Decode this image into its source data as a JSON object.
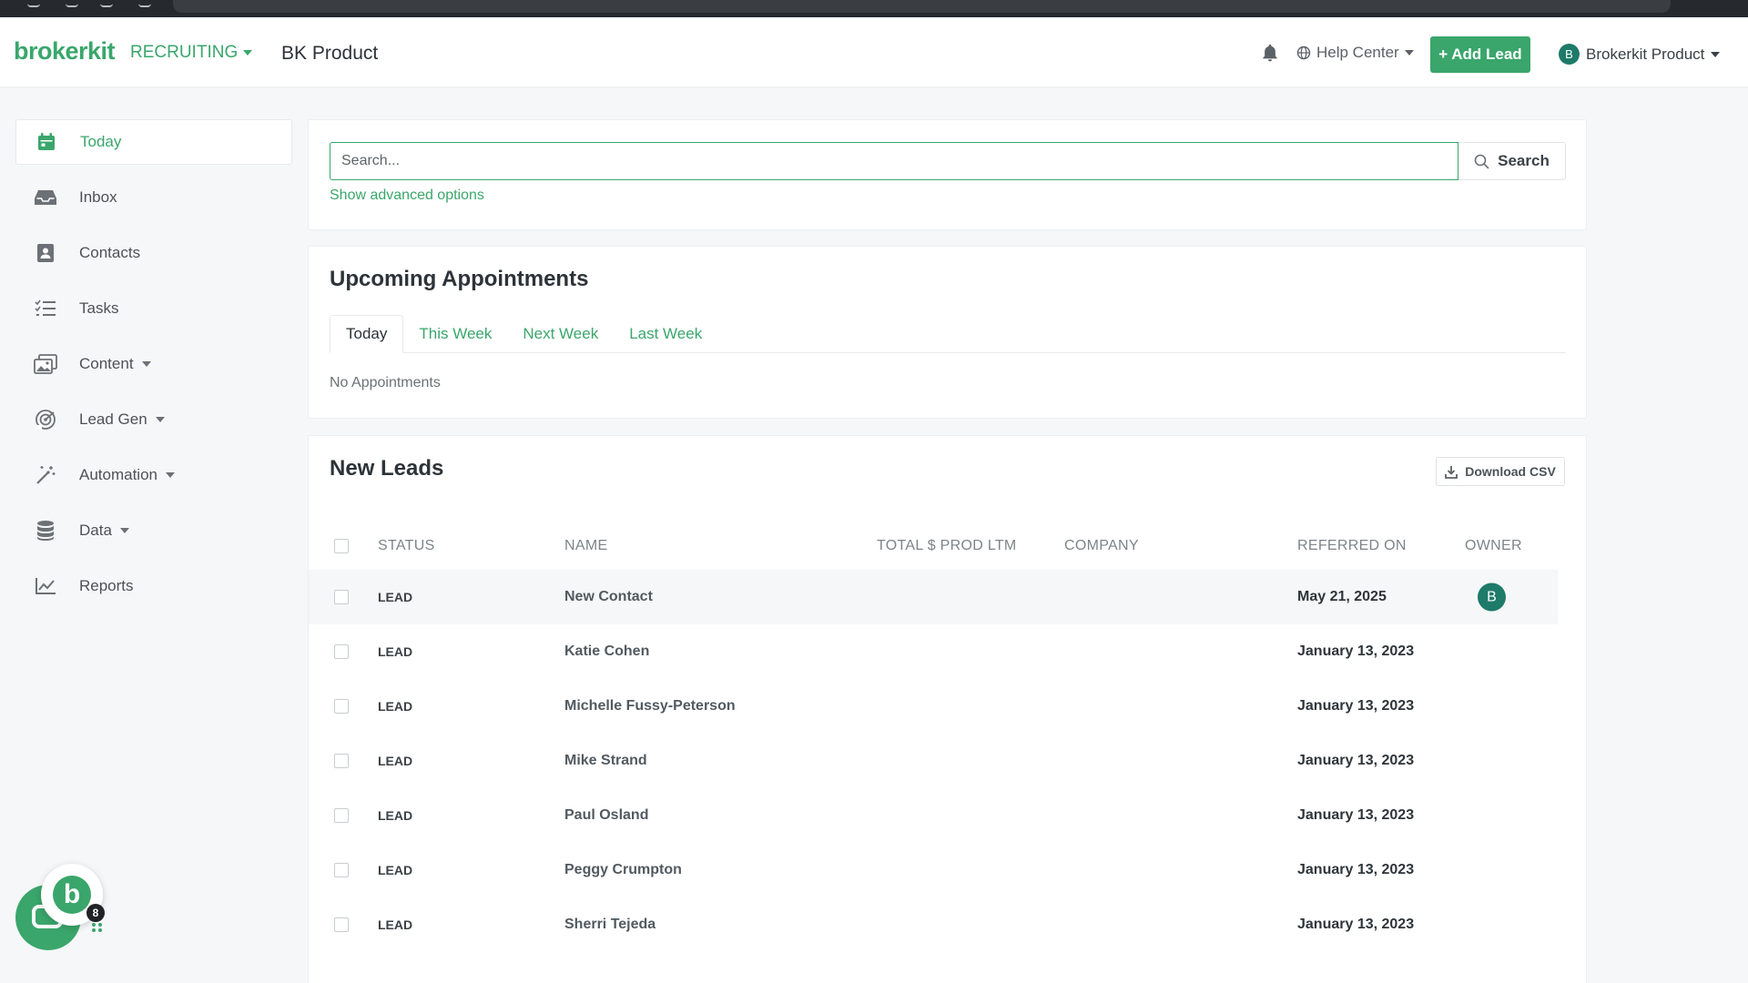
{
  "brand": {
    "logo": "brokerkit",
    "module": "RECRUITING",
    "org": "BK Product",
    "accent": "#3aa66b"
  },
  "header": {
    "help": "Help Center",
    "add_lead": "Add Lead",
    "user": "Brokerkit Product",
    "user_initial": "B"
  },
  "sidebar": {
    "items": [
      {
        "label": "Today",
        "icon": "calendar-icon"
      },
      {
        "label": "Inbox",
        "icon": "inbox-icon"
      },
      {
        "label": "Contacts",
        "icon": "contact-book-icon"
      },
      {
        "label": "Tasks",
        "icon": "task-list-icon"
      },
      {
        "label": "Content",
        "icon": "images-icon"
      },
      {
        "label": "Lead Gen",
        "icon": "radar-icon"
      },
      {
        "label": "Automation",
        "icon": "magic-wand-icon"
      },
      {
        "label": "Data",
        "icon": "database-icon"
      },
      {
        "label": "Reports",
        "icon": "chart-line-icon"
      }
    ]
  },
  "search": {
    "placeholder": "Search...",
    "button": "Search",
    "advanced": "Show advanced options"
  },
  "appointments": {
    "title": "Upcoming Appointments",
    "tabs": [
      "Today",
      "This Week",
      "Next Week",
      "Last Week"
    ],
    "empty": "No Appointments"
  },
  "leads": {
    "title": "New Leads",
    "csv": "Download CSV",
    "columns": {
      "status": "STATUS",
      "name": "NAME",
      "prod": "TOTAL $ PROD LTM",
      "company": "COMPANY",
      "referred": "REFERRED ON",
      "owner": "OWNER"
    },
    "rows": [
      {
        "status": "LEAD",
        "name": "New Contact",
        "prod": "",
        "company": "",
        "referred": "May 21, 2025",
        "owner": "B"
      },
      {
        "status": "LEAD",
        "name": "Katie Cohen",
        "prod": "",
        "company": "",
        "referred": "January 13, 2023",
        "owner": ""
      },
      {
        "status": "LEAD",
        "name": "Michelle Fussy-Peterson",
        "prod": "",
        "company": "",
        "referred": "January 13, 2023",
        "owner": ""
      },
      {
        "status": "LEAD",
        "name": "Mike Strand",
        "prod": "",
        "company": "",
        "referred": "January 13, 2023",
        "owner": ""
      },
      {
        "status": "LEAD",
        "name": "Paul Osland",
        "prod": "",
        "company": "",
        "referred": "January 13, 2023",
        "owner": ""
      },
      {
        "status": "LEAD",
        "name": "Peggy Crumpton",
        "prod": "",
        "company": "",
        "referred": "January 13, 2023",
        "owner": ""
      },
      {
        "status": "LEAD",
        "name": "Sherri Tejeda",
        "prod": "",
        "company": "",
        "referred": "January 13, 2023",
        "owner": ""
      }
    ]
  },
  "chat": {
    "badge": "8",
    "bot_letter": "b"
  }
}
